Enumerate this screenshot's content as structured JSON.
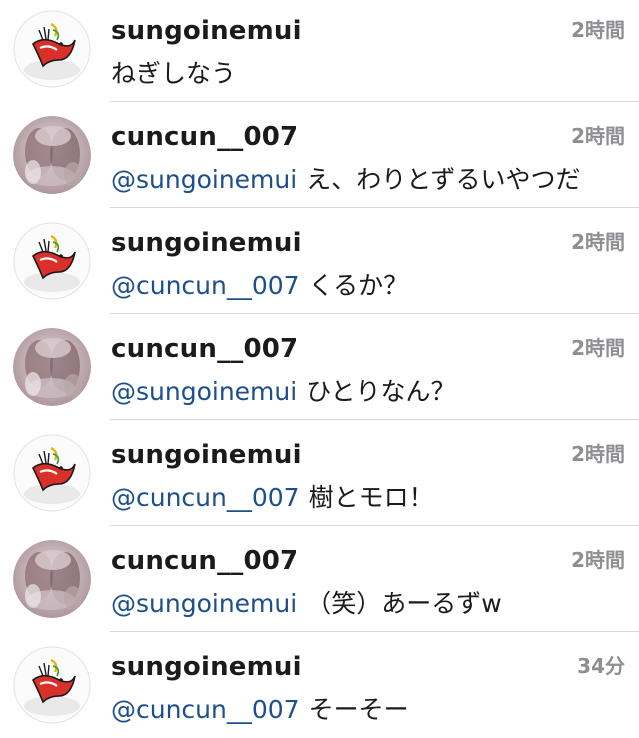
{
  "messages": [
    {
      "username": "sungoinemui",
      "time": "2時間",
      "mention": "",
      "text": "ねぎしなう",
      "avatar": "bird-sketch"
    },
    {
      "username": "cuncun__007",
      "time": "2時間",
      "mention": "@sungoinemui",
      "text": "え、わりとずるいやつだ",
      "avatar": "blurred-photo"
    },
    {
      "username": "sungoinemui",
      "time": "2時間",
      "mention": "@cuncun__007",
      "text": "くるか？",
      "avatar": "bird-sketch"
    },
    {
      "username": "cuncun__007",
      "time": "2時間",
      "mention": "@sungoinemui",
      "text": "ひとりなん？",
      "avatar": "blurred-photo"
    },
    {
      "username": "sungoinemui",
      "time": "2時間",
      "mention": "@cuncun__007",
      "text": "樹とモロ！",
      "avatar": "bird-sketch"
    },
    {
      "username": "cuncun__007",
      "time": "2時間",
      "mention": "@sungoinemui",
      "text": "（笑）あーるずw",
      "avatar": "blurred-photo"
    },
    {
      "username": "sungoinemui",
      "time": "34分",
      "mention": "@cuncun__007",
      "text": "そーそー",
      "avatar": "bird-sketch"
    }
  ],
  "colors": {
    "mention": "#1d4f8a",
    "time": "#8e8e93",
    "divider": "#d8d8dc"
  }
}
